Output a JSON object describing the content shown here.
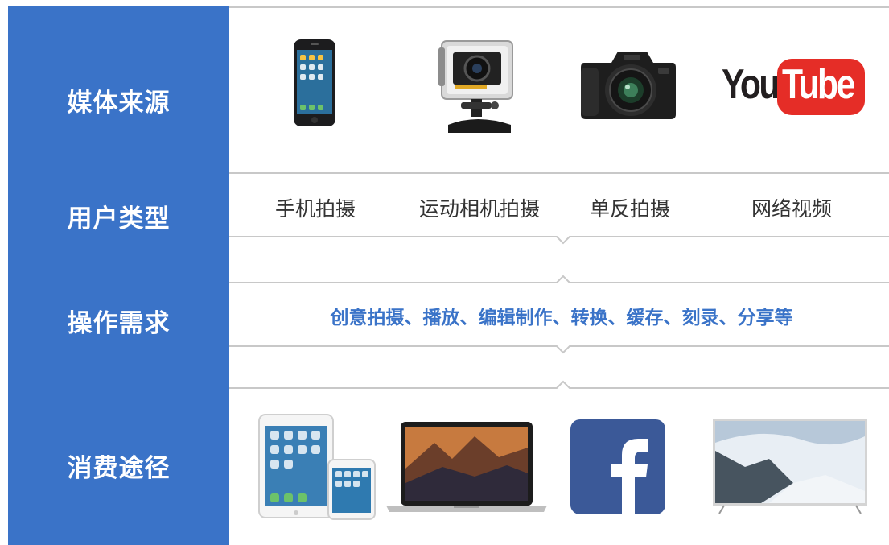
{
  "rows": [
    {
      "label": "媒体来源"
    },
    {
      "label": "用户类型"
    },
    {
      "label": "操作需求"
    },
    {
      "label": "消费途径"
    }
  ],
  "user_types": [
    "手机拍摄",
    "运动相机拍摄",
    "单反拍摄",
    "网络视频"
  ],
  "operations": "创意拍摄、播放、编辑制作、转换、缓存、刻录、分享等",
  "youtube": {
    "you": "You",
    "tube": "Tube"
  },
  "colors": {
    "accent": "#3a73c8",
    "youtube_red": "#e52d27",
    "facebook_blue": "#3b5998"
  },
  "media_sources": [
    "smartphone-icon",
    "action-camera-icon",
    "dslr-camera-icon",
    "youtube-logo"
  ],
  "consumption": [
    "tablet-phone-icon",
    "laptop-icon",
    "facebook-logo",
    "tv-icon"
  ]
}
